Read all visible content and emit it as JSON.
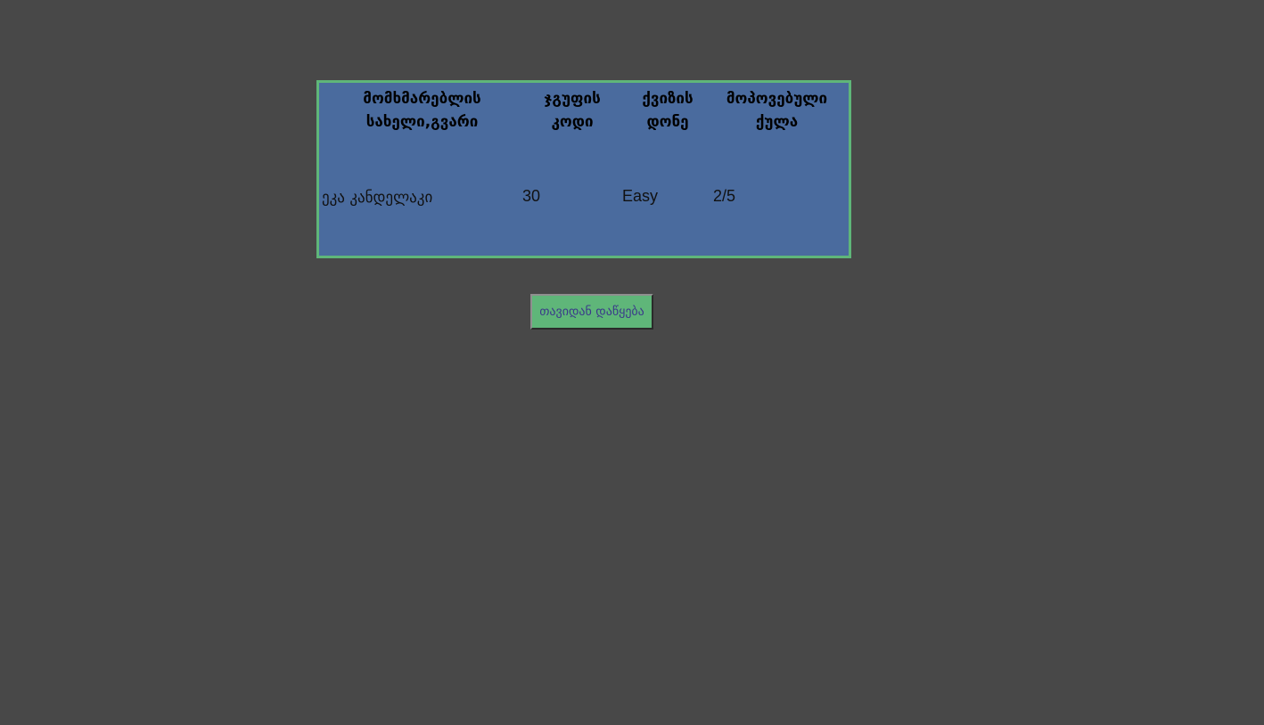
{
  "results_table": {
    "columns": [
      "მომხმარებლის სახელი,გვარი",
      "ჯგუფის კოდი",
      "ქვიზის დონე",
      "მოპოვებული ქულა"
    ],
    "rows": [
      {
        "name": "ეკა კანდელაკი",
        "group_code": "30",
        "quiz_level": "Easy",
        "score": "2/5"
      }
    ]
  },
  "restart_button": {
    "label": "თავიდან დაწყება"
  },
  "colors": {
    "page_background": "#484848",
    "panel_background": "#4a6b9e",
    "panel_border": "#5fb679",
    "button_background": "#5fb679",
    "button_text": "#3a3a8a"
  }
}
